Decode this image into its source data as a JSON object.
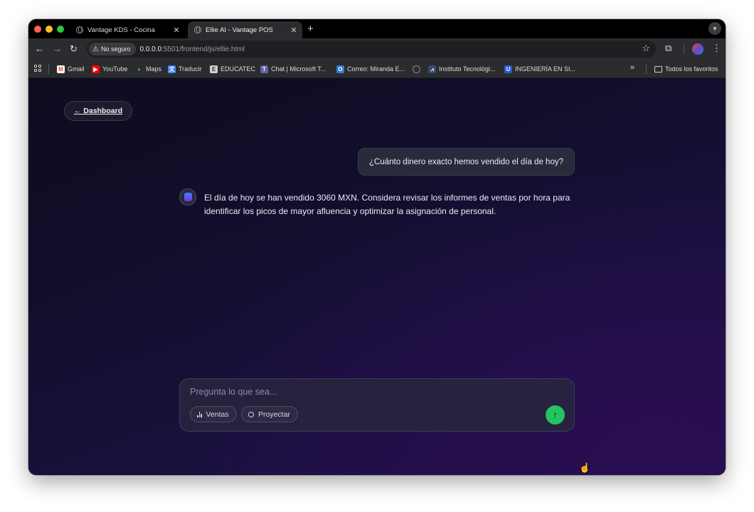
{
  "browser": {
    "tabs": [
      {
        "title": "Vantage KDS - Cocina",
        "active": false
      },
      {
        "title": "Ellie AI - Vantage POS",
        "active": true
      }
    ],
    "new_tab": "+",
    "close_glyph": "✕",
    "security_label": "No seguro",
    "url_host": "0.0.0.0",
    "url_rest": ":5501/frontend/js/ellie.html"
  },
  "bookmarks": {
    "items": [
      {
        "label": "Gmail",
        "icon": "gmail-icon",
        "color": "#ea4335"
      },
      {
        "label": "YouTube",
        "icon": "youtube-icon",
        "color": "#ff0000"
      },
      {
        "label": "Maps",
        "icon": "maps-icon",
        "color": "#34a853"
      },
      {
        "label": "Traducir",
        "icon": "translate-icon",
        "color": "#4285f4"
      },
      {
        "label": "EDUCATEC",
        "icon": "educatec-icon",
        "color": "#cfcfcf"
      },
      {
        "label": "Chat | Microsoft T...",
        "icon": "teams-icon",
        "color": "#6264a7"
      },
      {
        "label": "Correo: Miranda E...",
        "icon": "outlook-icon",
        "color": "#2f7ad6"
      },
      {
        "label": "",
        "icon": "globe-icon",
        "color": "#7a7a7a"
      },
      {
        "label": "Instituto Tecnológi...",
        "icon": "instituto-icon",
        "color": "#3b4a6b"
      },
      {
        "label": "INGENIERÍA EN SI...",
        "icon": "ingenieria-icon",
        "color": "#2c5bd6"
      }
    ],
    "more": "»",
    "all_favorites": "Todos los favoritos"
  },
  "page": {
    "back_button": "← Dashboard",
    "user_message": "¿Cuánto dinero exacto hemos vendido el día de hoy?",
    "assistant_message": "El día de hoy se han vendido 3060 MXN. Considera revisar los informes de ventas por hora para identificar los picos de mayor afluencia y optimizar la asignación de personal.",
    "composer": {
      "placeholder": "Pregunta lo que sea...",
      "chips": [
        {
          "label": "Ventas",
          "icon": "bar-chart-icon"
        },
        {
          "label": "Proyectar",
          "icon": "circle-icon"
        }
      ],
      "send_icon": "arrow-up-icon"
    }
  },
  "colors": {
    "accent_send": "#22c55e",
    "page_bg_start": "#0d0c1f",
    "page_bg_end": "#22104a"
  }
}
